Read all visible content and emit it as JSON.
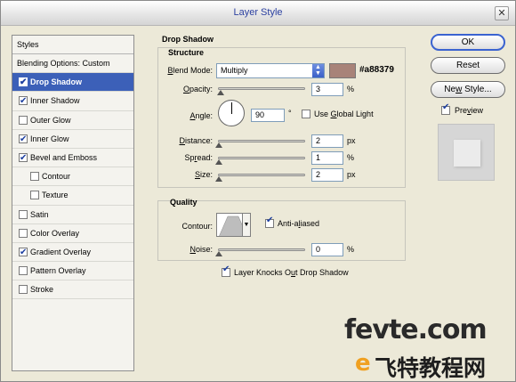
{
  "window": {
    "title": "Layer Style",
    "close_glyph": "✕"
  },
  "styles_panel": {
    "header": "Styles",
    "items": [
      {
        "label": "Blending Options: Custom",
        "checkbox": false,
        "checked": false,
        "indent": false,
        "selected": false
      },
      {
        "label": "Drop Shadow",
        "checkbox": true,
        "checked": true,
        "indent": false,
        "selected": true
      },
      {
        "label": "Inner Shadow",
        "checkbox": true,
        "checked": true,
        "indent": false,
        "selected": false
      },
      {
        "label": "Outer Glow",
        "checkbox": true,
        "checked": false,
        "indent": false,
        "selected": false
      },
      {
        "label": "Inner Glow",
        "checkbox": true,
        "checked": true,
        "indent": false,
        "selected": false
      },
      {
        "label": "Bevel and Emboss",
        "checkbox": true,
        "checked": true,
        "indent": false,
        "selected": false
      },
      {
        "label": "Contour",
        "checkbox": true,
        "checked": false,
        "indent": true,
        "selected": false
      },
      {
        "label": "Texture",
        "checkbox": true,
        "checked": false,
        "indent": true,
        "selected": false
      },
      {
        "label": "Satin",
        "checkbox": true,
        "checked": false,
        "indent": false,
        "selected": false
      },
      {
        "label": "Color Overlay",
        "checkbox": true,
        "checked": false,
        "indent": false,
        "selected": false
      },
      {
        "label": "Gradient Overlay",
        "checkbox": true,
        "checked": true,
        "indent": false,
        "selected": false
      },
      {
        "label": "Pattern Overlay",
        "checkbox": true,
        "checked": false,
        "indent": false,
        "selected": false
      },
      {
        "label": "Stroke",
        "checkbox": true,
        "checked": false,
        "indent": false,
        "selected": false
      }
    ]
  },
  "drop_shadow": {
    "section_title": "Drop Shadow",
    "structure_title": "Structure",
    "blend_mode": {
      "label_pre": "",
      "label_underline": "B",
      "label_post": "lend Mode:",
      "value": "Multiply",
      "color": "#a88379",
      "hex_text": "#a88379"
    },
    "opacity": {
      "label_underline": "O",
      "label_post": "pacity:",
      "value": "3",
      "unit": "%"
    },
    "angle": {
      "label_underline": "A",
      "label_post": "ngle:",
      "value": "90",
      "unit": "°",
      "global_light_pre": "Use ",
      "global_light_underline": "G",
      "global_light_post": "lobal Light",
      "global_light_checked": false
    },
    "distance": {
      "label_underline": "D",
      "label_post": "istance:",
      "value": "2",
      "unit": "px"
    },
    "spread": {
      "label_pre": "Sp",
      "label_underline": "r",
      "label_post": "ead:",
      "value": "1",
      "unit": "%"
    },
    "size": {
      "label_underline": "S",
      "label_post": "ize:",
      "value": "2",
      "unit": "px"
    }
  },
  "quality": {
    "title": "Quality",
    "contour_label": "Contour:",
    "anti_aliased_label_pre": "Anti-a",
    "anti_aliased_label_underline": "l",
    "anti_aliased_label_post": "iased",
    "anti_aliased_checked": true,
    "noise": {
      "label_underline": "N",
      "label_post": "oise:",
      "value": "0",
      "unit": "%"
    },
    "knockout_label_pre": "Layer Knocks O",
    "knockout_label_underline": "u",
    "knockout_label_post": "t Drop Shadow",
    "knockout_checked": true
  },
  "buttons": {
    "ok": "OK",
    "reset": "Reset",
    "new_style_pre": "Ne",
    "new_style_underline": "w",
    "new_style_post": " Style...",
    "preview_pre": "Pre",
    "preview_underline": "v",
    "preview_post": "iew",
    "preview_checked": true
  },
  "watermark": {
    "line1": "fevte.com",
    "logo_letter": "e",
    "line2": "飞特教程网"
  }
}
